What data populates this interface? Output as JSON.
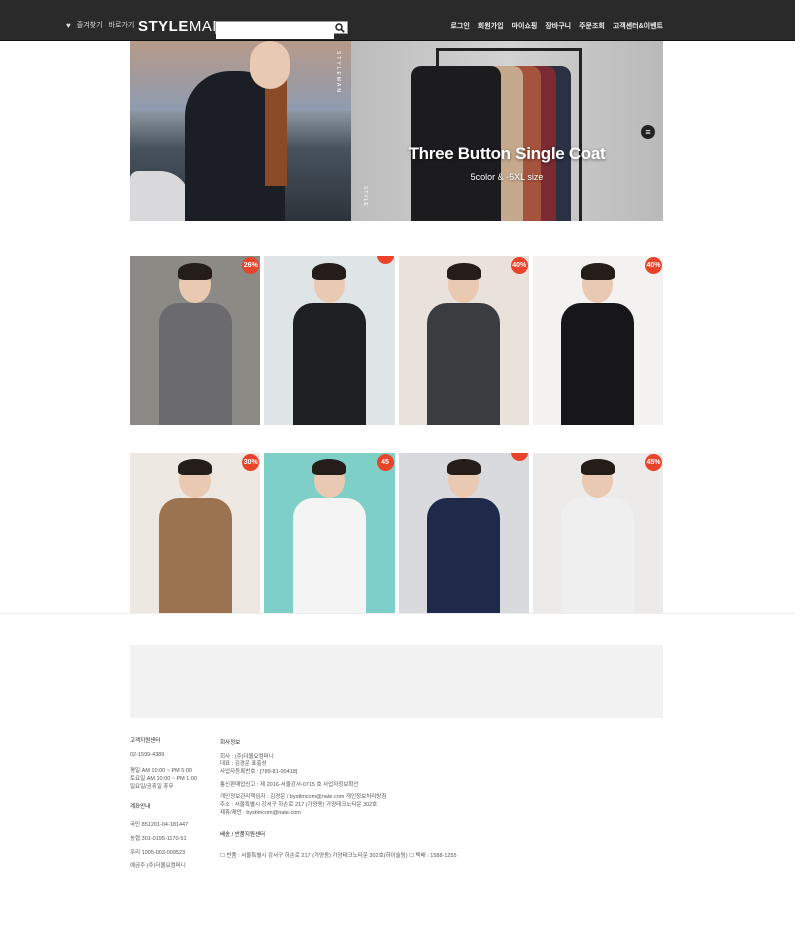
{
  "header": {
    "bookmark_label": "즐겨찾기",
    "shortcut_label": "바로가기",
    "logo_bold": "STYLE",
    "logo_light": "MAN",
    "search_placeholder": "",
    "nav": [
      "로그인",
      "회원가입",
      "마이쇼핑",
      "장바구니",
      "주문조회",
      "고객센터&이벤트"
    ]
  },
  "hero": {
    "title": "Three Button Single Coat",
    "subtitle": "5color & -5XL size",
    "vertical_text": "STYLEMAN",
    "vertical_text_2": "STYLE"
  },
  "products_row1": [
    {
      "badge": "26%",
      "bg": "#8c8a84",
      "figure": "#6b6a6e"
    },
    {
      "badge": "",
      "bg": "#dfe5e6",
      "figure": "#1e1f22"
    },
    {
      "badge": "40%",
      "bg": "#e8e2da",
      "figure": "#3b3c40"
    },
    {
      "badge": "40%",
      "bg": "#f3f2f0",
      "figure": "#17171a"
    }
  ],
  "products_row2": [
    {
      "badge": "30%",
      "bg": "#ede8e2",
      "figure": "#9c7350"
    },
    {
      "badge": "45",
      "bg": "#7fcfc9",
      "figure": "#f4f4f4"
    },
    {
      "badge": "",
      "bg": "#d8dadd",
      "figure": "#1f2a4a"
    },
    {
      "badge": "45%",
      "bg": "#ecebea",
      "figure": "#efefef"
    }
  ],
  "footer": {
    "cs_title": "고객지원센터",
    "cs_phone": "02-1599-4389",
    "cs_hours_1": "평일 AM 10:00 ~ PM 5:00",
    "cs_hours_2": "토요일 AM 10:00 ~ PM 1:00",
    "cs_hours_3": "일요일/공휴일 휴무",
    "bank_title": "계좌안내",
    "bank_1": "국민 851201-04-181447",
    "bank_2": "농협 301-0195-1170-51",
    "bank_3": "우리 1005-003-009523",
    "bank_holder": "예금주 (주)더몰요컴퍼니",
    "company_title": "회사정보",
    "company_1": "회사 : (주)더몰요컴퍼니",
    "company_2": "대표 : 김경운 표홍성",
    "company_3": "사업자등록번호 : [789-81-00418]",
    "company_4": "통신판매업신고 : 제 2016-서울강서-0715 호 사업자정보확인",
    "company_5": "개인정보관리책임자 : 김경운 / bystlmcom@nate.com 개인정보처리방침",
    "company_6": "주소 : 서울특별시 강서구 하손로 217 (가양동) 가양테크노타운 302호",
    "company_7": "제휴/제안 : bystlmcom@nate.com",
    "return_title": "배송 / 반품지원센터",
    "return_line": "☐ 반품 : 서울특별시 강서구 하손로 217 (가양동) 가양테크노타운 302호(하이슬링) ☐ 택배 : 1588-1255"
  }
}
